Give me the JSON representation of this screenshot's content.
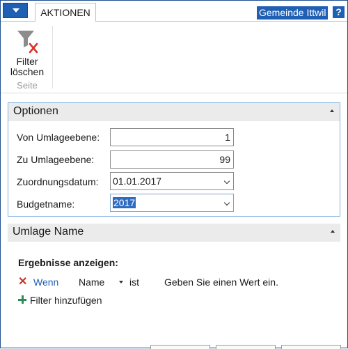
{
  "ribbon": {
    "tab_label": "AKTIONEN",
    "company_name": "Gemeinde Ittwil",
    "help_glyph": "?",
    "filter_button": {
      "line1": "Filter",
      "line2": "löschen",
      "icon": "filter-clear-icon"
    },
    "group_label": "Seite"
  },
  "options": {
    "title": "Optionen",
    "fields": [
      {
        "label": "Von Umlageebene:",
        "value": "1"
      },
      {
        "label": "Zu Umlageebene:",
        "value": "99"
      },
      {
        "label": "Zuordnungsdatum:",
        "value": "01.01.2017"
      },
      {
        "label": "Budgetname:",
        "value": "2017"
      }
    ]
  },
  "umlage": {
    "title": "Umlage Name"
  },
  "filters": {
    "heading": "Ergebnisse anzeigen:",
    "row": {
      "connector": "Wenn",
      "field": "Name",
      "operator": "ist",
      "value": "Geben Sie einen Wert ein."
    },
    "add_label": "Filter hinzufügen"
  },
  "colors": {
    "accent": "#1f5fb4",
    "remove": "#c0392b",
    "add": "#2e8b57"
  }
}
